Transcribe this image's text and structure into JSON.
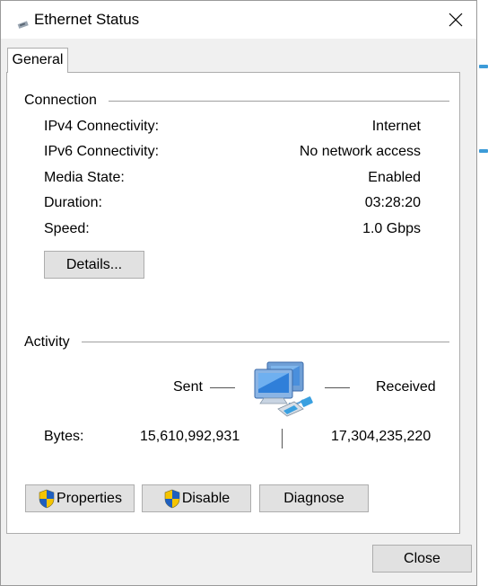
{
  "window": {
    "title": "Ethernet Status",
    "close_icon": "close-icon"
  },
  "tabs": [
    {
      "label": "General",
      "selected": true
    }
  ],
  "connection": {
    "heading": "Connection",
    "rows": [
      {
        "label": "IPv4 Connectivity:",
        "value": "Internet"
      },
      {
        "label": "IPv6 Connectivity:",
        "value": "No network access"
      },
      {
        "label": "Media State:",
        "value": "Enabled"
      },
      {
        "label": "Duration:",
        "value": "03:28:20"
      },
      {
        "label": "Speed:",
        "value": "1.0 Gbps"
      }
    ],
    "details_button": "Details..."
  },
  "activity": {
    "heading": "Activity",
    "sent_label": "Sent",
    "received_label": "Received",
    "bytes_label": "Bytes:",
    "bytes_sent": "15,610,992,931",
    "bytes_received": "17,304,235,220",
    "icon": "network-computers-icon"
  },
  "actions": {
    "properties": "Properties",
    "disable": "Disable",
    "diagnose": "Diagnose",
    "shield_icon": "uac-shield-icon"
  },
  "footer": {
    "close": "Close"
  },
  "colors": {
    "dialog_bg": "#f0f0f0",
    "panel_bg": "#ffffff",
    "button_bg": "#e1e1e1",
    "shield_blue": "#1f5fbf",
    "shield_yellow": "#f5c400"
  }
}
